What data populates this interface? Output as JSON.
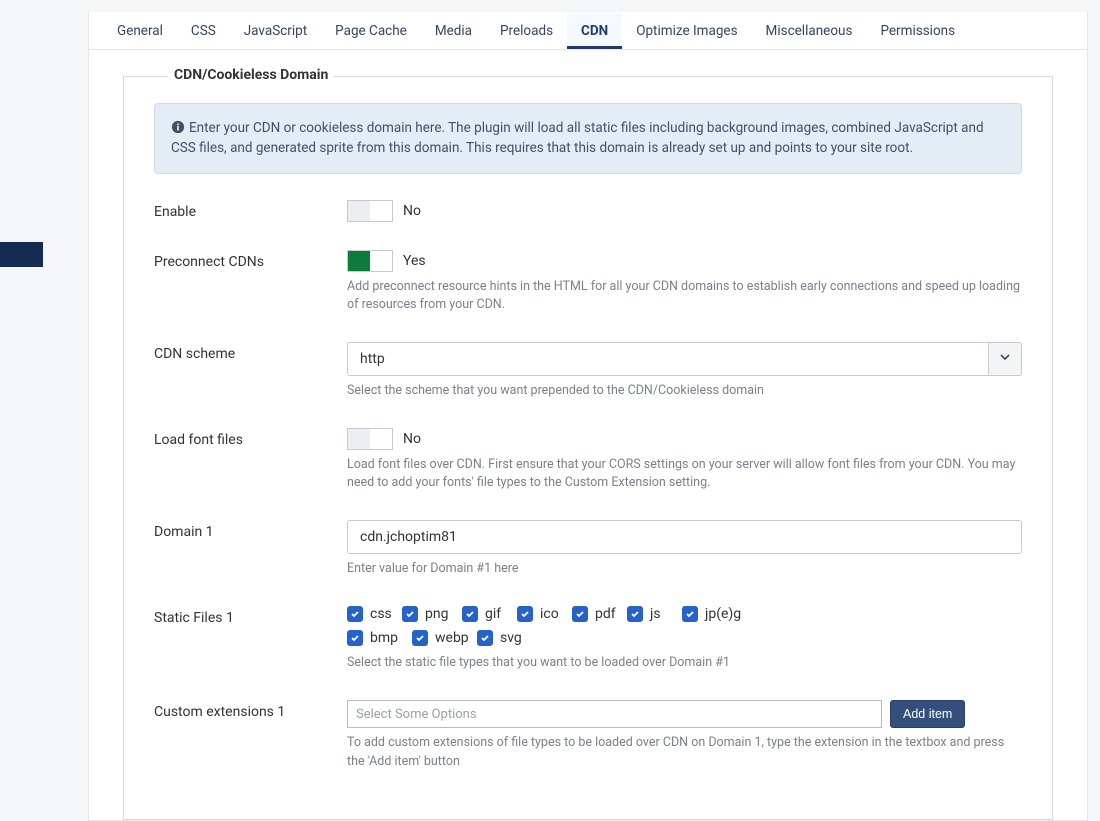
{
  "tabs": [
    {
      "label": "General",
      "active": false
    },
    {
      "label": "CSS",
      "active": false
    },
    {
      "label": "JavaScript",
      "active": false
    },
    {
      "label": "Page Cache",
      "active": false
    },
    {
      "label": "Media",
      "active": false
    },
    {
      "label": "Preloads",
      "active": false
    },
    {
      "label": "CDN",
      "active": true
    },
    {
      "label": "Optimize Images",
      "active": false
    },
    {
      "label": "Miscellaneous",
      "active": false
    },
    {
      "label": "Permissions",
      "active": false
    }
  ],
  "section": {
    "title": "CDN/Cookieless Domain",
    "info": "Enter your CDN or cookieless domain here. The plugin will load all static files including background images, combined JavaScript and CSS files, and generated sprite from this domain. This requires that this domain is already set up and points to your site root."
  },
  "fields": {
    "enable": {
      "label": "Enable",
      "value": "No",
      "on": false
    },
    "preconnect": {
      "label": "Preconnect CDNs",
      "value": "Yes",
      "on": true,
      "help": "Add preconnect resource hints in the HTML for all your CDN domains to establish early connections and speed up loading of resources from your CDN."
    },
    "scheme": {
      "label": "CDN scheme",
      "value": "http",
      "help": "Select the scheme that you want prepended to the CDN/Cookieless domain"
    },
    "fonts": {
      "label": "Load font files",
      "value": "No",
      "on": false,
      "help": "Load font files over CDN. First ensure that your CORS settings on your server will allow font files from your CDN. You may need to add your fonts' file types to the Custom Extension setting."
    },
    "domain1": {
      "label": "Domain 1",
      "value": "cdn.jchoptim81",
      "help": "Enter value for Domain #1 here"
    },
    "static1": {
      "label": "Static Files 1",
      "items": [
        {
          "label": "css"
        },
        {
          "label": "png"
        },
        {
          "label": "gif"
        },
        {
          "label": "ico"
        },
        {
          "label": "pdf"
        },
        {
          "label": "js"
        },
        {
          "label": "jp(e)g"
        },
        {
          "label": "bmp"
        },
        {
          "label": "webp"
        },
        {
          "label": "svg"
        }
      ],
      "help": "Select the static file types that you want to be loaded over Domain #1"
    },
    "custom1": {
      "label": "Custom extensions 1",
      "placeholder": "Select Some Options",
      "button": "Add item",
      "help": "To add custom extensions of file types to be loaded over CDN on Domain 1, type the extension in the textbox and press the 'Add item' button"
    }
  }
}
